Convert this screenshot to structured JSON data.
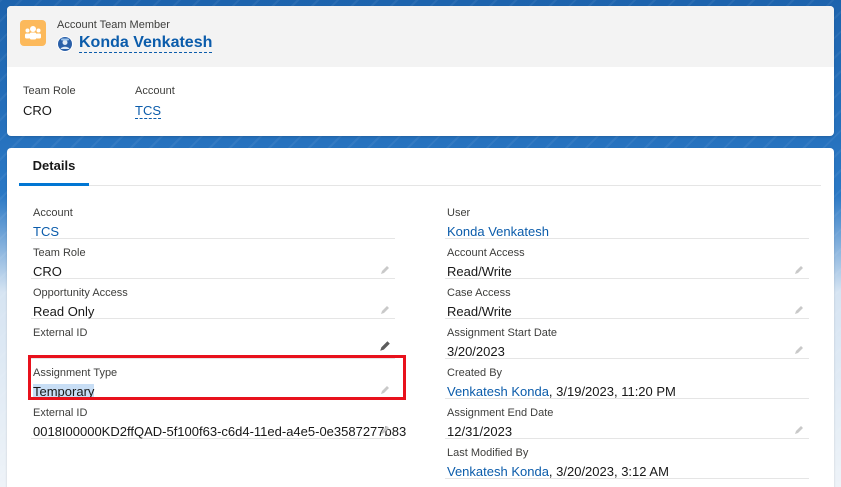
{
  "header": {
    "object_label": "Account Team Member",
    "record_name": "Konda Venkatesh",
    "highlights": [
      {
        "label": "Team Role",
        "value": "CRO",
        "link": false
      },
      {
        "label": "Account",
        "value": "TCS",
        "link": true
      }
    ]
  },
  "tabs": [
    {
      "label": "Details"
    }
  ],
  "details": {
    "left": [
      {
        "label": "Account",
        "value": "TCS",
        "link": true,
        "editable": false
      },
      {
        "label": "Team Role",
        "value": "CRO",
        "link": false,
        "editable": true
      },
      {
        "label": "Opportunity Access",
        "value": "Read Only",
        "link": false,
        "editable": true
      },
      {
        "label": "External ID",
        "value": "",
        "link": false,
        "editable": true
      },
      {
        "label": "Assignment Type",
        "value": "Temporary",
        "link": false,
        "editable": true
      },
      {
        "label": "External ID",
        "value": "0018I00000KD2ffQAD-5f100f63-c6d4-11ed-a4e5-0e3587277b83",
        "link": false,
        "editable": true
      }
    ],
    "right": [
      {
        "label": "User",
        "value": "Konda Venkatesh",
        "link": true,
        "editable": false
      },
      {
        "label": "Account Access",
        "value": "Read/Write",
        "link": false,
        "editable": true
      },
      {
        "label": "Case Access",
        "value": "Read/Write",
        "link": false,
        "editable": true
      },
      {
        "label": "Assignment Start Date",
        "value": "3/20/2023",
        "link": false,
        "editable": true
      },
      {
        "label": "Created By",
        "value_link": "Venkatesh Konda",
        "value_rest": ", 3/19/2023, 11:20 PM",
        "editable": false
      },
      {
        "label": "Assignment End Date",
        "value": "12/31/2023",
        "link": false,
        "editable": true
      },
      {
        "label": "Last Modified By",
        "value_link": "Venkatesh Konda",
        "value_rest": ", 3/20/2023, 3:12 AM",
        "editable": false
      }
    ]
  },
  "icons": {
    "object": "team-member-icon",
    "avatar": "user-avatar-icon",
    "edit": "pencil-icon"
  },
  "colors": {
    "link": "#0b5cab",
    "highlight_box": "#e8111c",
    "object_icon_bg": "#fcb95b",
    "tab_active": "#0176d3"
  }
}
